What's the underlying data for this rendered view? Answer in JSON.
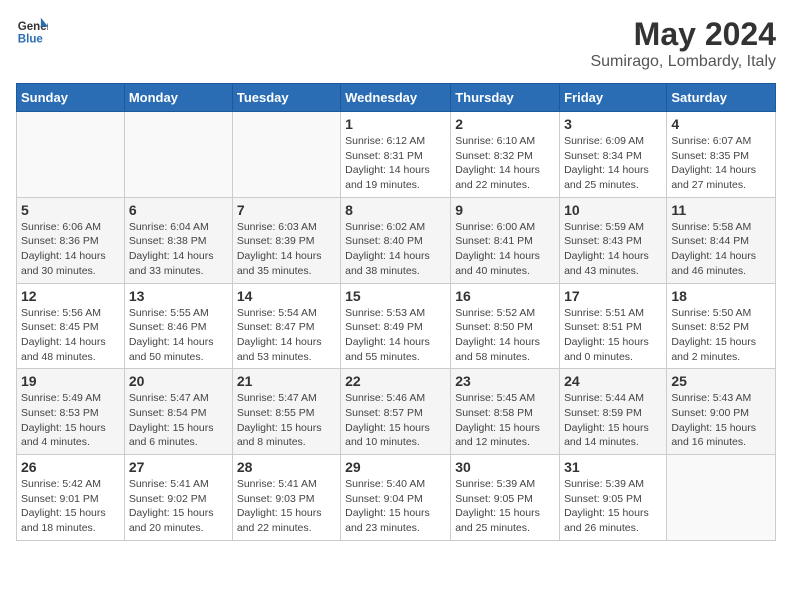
{
  "logo": {
    "general": "General",
    "blue": "Blue"
  },
  "title": "May 2024",
  "location": "Sumirago, Lombardy, Italy",
  "weekdays": [
    "Sunday",
    "Monday",
    "Tuesday",
    "Wednesday",
    "Thursday",
    "Friday",
    "Saturday"
  ],
  "weeks": [
    [
      {
        "day": "",
        "info": ""
      },
      {
        "day": "",
        "info": ""
      },
      {
        "day": "",
        "info": ""
      },
      {
        "day": "1",
        "info": "Sunrise: 6:12 AM\nSunset: 8:31 PM\nDaylight: 14 hours\nand 19 minutes."
      },
      {
        "day": "2",
        "info": "Sunrise: 6:10 AM\nSunset: 8:32 PM\nDaylight: 14 hours\nand 22 minutes."
      },
      {
        "day": "3",
        "info": "Sunrise: 6:09 AM\nSunset: 8:34 PM\nDaylight: 14 hours\nand 25 minutes."
      },
      {
        "day": "4",
        "info": "Sunrise: 6:07 AM\nSunset: 8:35 PM\nDaylight: 14 hours\nand 27 minutes."
      }
    ],
    [
      {
        "day": "5",
        "info": "Sunrise: 6:06 AM\nSunset: 8:36 PM\nDaylight: 14 hours\nand 30 minutes."
      },
      {
        "day": "6",
        "info": "Sunrise: 6:04 AM\nSunset: 8:38 PM\nDaylight: 14 hours\nand 33 minutes."
      },
      {
        "day": "7",
        "info": "Sunrise: 6:03 AM\nSunset: 8:39 PM\nDaylight: 14 hours\nand 35 minutes."
      },
      {
        "day": "8",
        "info": "Sunrise: 6:02 AM\nSunset: 8:40 PM\nDaylight: 14 hours\nand 38 minutes."
      },
      {
        "day": "9",
        "info": "Sunrise: 6:00 AM\nSunset: 8:41 PM\nDaylight: 14 hours\nand 40 minutes."
      },
      {
        "day": "10",
        "info": "Sunrise: 5:59 AM\nSunset: 8:43 PM\nDaylight: 14 hours\nand 43 minutes."
      },
      {
        "day": "11",
        "info": "Sunrise: 5:58 AM\nSunset: 8:44 PM\nDaylight: 14 hours\nand 46 minutes."
      }
    ],
    [
      {
        "day": "12",
        "info": "Sunrise: 5:56 AM\nSunset: 8:45 PM\nDaylight: 14 hours\nand 48 minutes."
      },
      {
        "day": "13",
        "info": "Sunrise: 5:55 AM\nSunset: 8:46 PM\nDaylight: 14 hours\nand 50 minutes."
      },
      {
        "day": "14",
        "info": "Sunrise: 5:54 AM\nSunset: 8:47 PM\nDaylight: 14 hours\nand 53 minutes."
      },
      {
        "day": "15",
        "info": "Sunrise: 5:53 AM\nSunset: 8:49 PM\nDaylight: 14 hours\nand 55 minutes."
      },
      {
        "day": "16",
        "info": "Sunrise: 5:52 AM\nSunset: 8:50 PM\nDaylight: 14 hours\nand 58 minutes."
      },
      {
        "day": "17",
        "info": "Sunrise: 5:51 AM\nSunset: 8:51 PM\nDaylight: 15 hours\nand 0 minutes."
      },
      {
        "day": "18",
        "info": "Sunrise: 5:50 AM\nSunset: 8:52 PM\nDaylight: 15 hours\nand 2 minutes."
      }
    ],
    [
      {
        "day": "19",
        "info": "Sunrise: 5:49 AM\nSunset: 8:53 PM\nDaylight: 15 hours\nand 4 minutes."
      },
      {
        "day": "20",
        "info": "Sunrise: 5:47 AM\nSunset: 8:54 PM\nDaylight: 15 hours\nand 6 minutes."
      },
      {
        "day": "21",
        "info": "Sunrise: 5:47 AM\nSunset: 8:55 PM\nDaylight: 15 hours\nand 8 minutes."
      },
      {
        "day": "22",
        "info": "Sunrise: 5:46 AM\nSunset: 8:57 PM\nDaylight: 15 hours\nand 10 minutes."
      },
      {
        "day": "23",
        "info": "Sunrise: 5:45 AM\nSunset: 8:58 PM\nDaylight: 15 hours\nand 12 minutes."
      },
      {
        "day": "24",
        "info": "Sunrise: 5:44 AM\nSunset: 8:59 PM\nDaylight: 15 hours\nand 14 minutes."
      },
      {
        "day": "25",
        "info": "Sunrise: 5:43 AM\nSunset: 9:00 PM\nDaylight: 15 hours\nand 16 minutes."
      }
    ],
    [
      {
        "day": "26",
        "info": "Sunrise: 5:42 AM\nSunset: 9:01 PM\nDaylight: 15 hours\nand 18 minutes."
      },
      {
        "day": "27",
        "info": "Sunrise: 5:41 AM\nSunset: 9:02 PM\nDaylight: 15 hours\nand 20 minutes."
      },
      {
        "day": "28",
        "info": "Sunrise: 5:41 AM\nSunset: 9:03 PM\nDaylight: 15 hours\nand 22 minutes."
      },
      {
        "day": "29",
        "info": "Sunrise: 5:40 AM\nSunset: 9:04 PM\nDaylight: 15 hours\nand 23 minutes."
      },
      {
        "day": "30",
        "info": "Sunrise: 5:39 AM\nSunset: 9:05 PM\nDaylight: 15 hours\nand 25 minutes."
      },
      {
        "day": "31",
        "info": "Sunrise: 5:39 AM\nSunset: 9:05 PM\nDaylight: 15 hours\nand 26 minutes."
      },
      {
        "day": "",
        "info": ""
      }
    ]
  ]
}
